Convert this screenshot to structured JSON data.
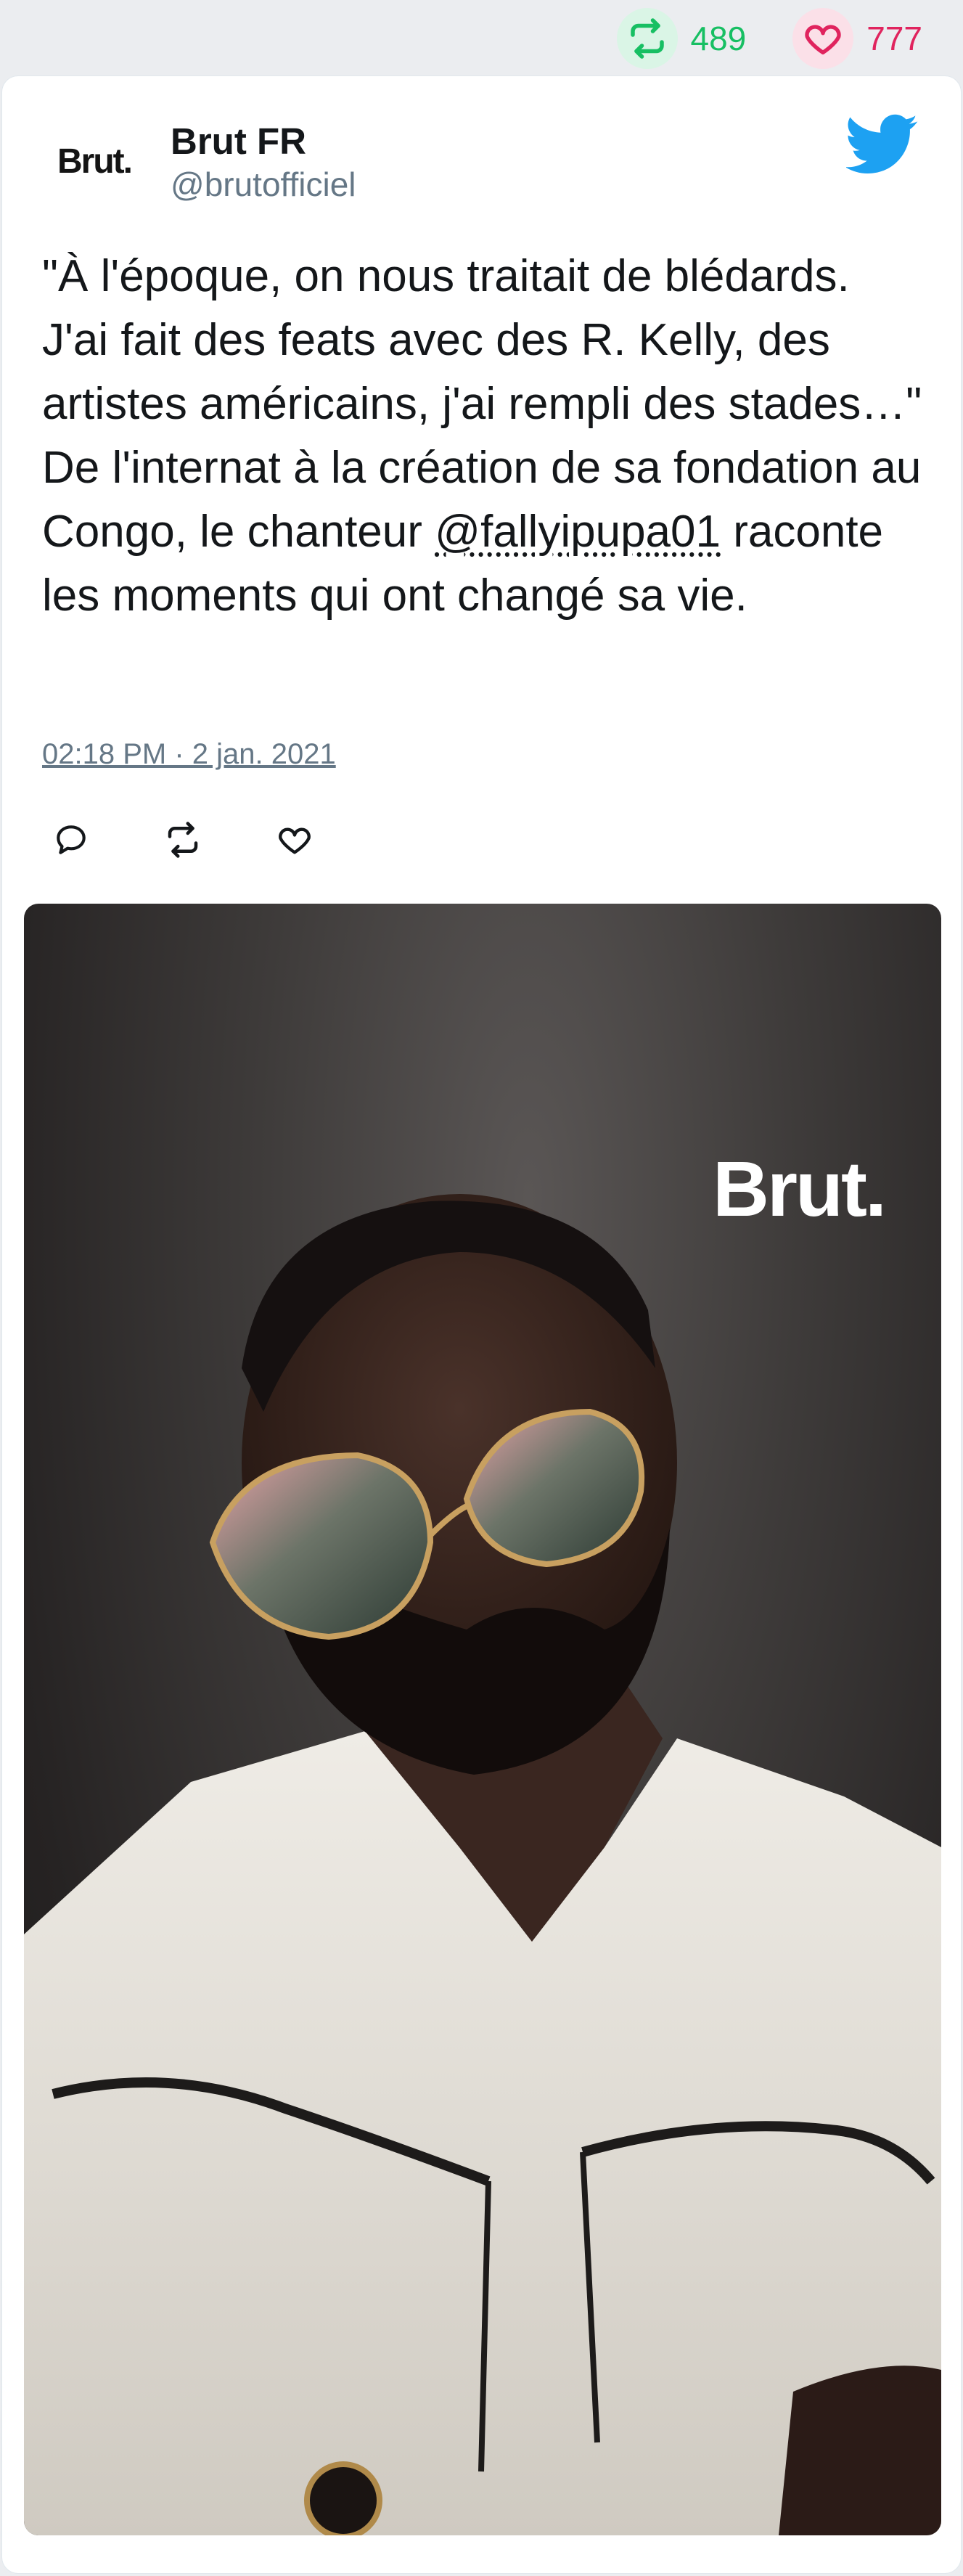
{
  "stats": {
    "retweets": "489",
    "likes": "777"
  },
  "author": {
    "avatar_text": "Brut.",
    "name": "Brut FR",
    "handle": "@brutofficiel"
  },
  "tweet": {
    "text_before": "\"À l'époque, on nous traitait de blédards. J'ai fait des feats avec des R. Kelly, des artistes américains, j'ai rempli des stades…\" De l'internat à la création de sa fondation au Congo, le chanteur ",
    "mention": "@fallyipupa01",
    "text_after": " raconte les moments qui ont changé sa vie.",
    "timestamp": "02:18 PM · 2 jan. 2021"
  },
  "media": {
    "logo_text": "Brut."
  },
  "colors": {
    "retweet": "#17bf63",
    "like": "#e0245e",
    "twitter_blue": "#1da1f2",
    "secondary_text": "#657786",
    "primary_text": "#14171a"
  },
  "icons": {
    "retweet": "retweet-icon",
    "like": "heart-icon",
    "reply": "reply-icon",
    "brand": "twitter-bird-icon"
  }
}
